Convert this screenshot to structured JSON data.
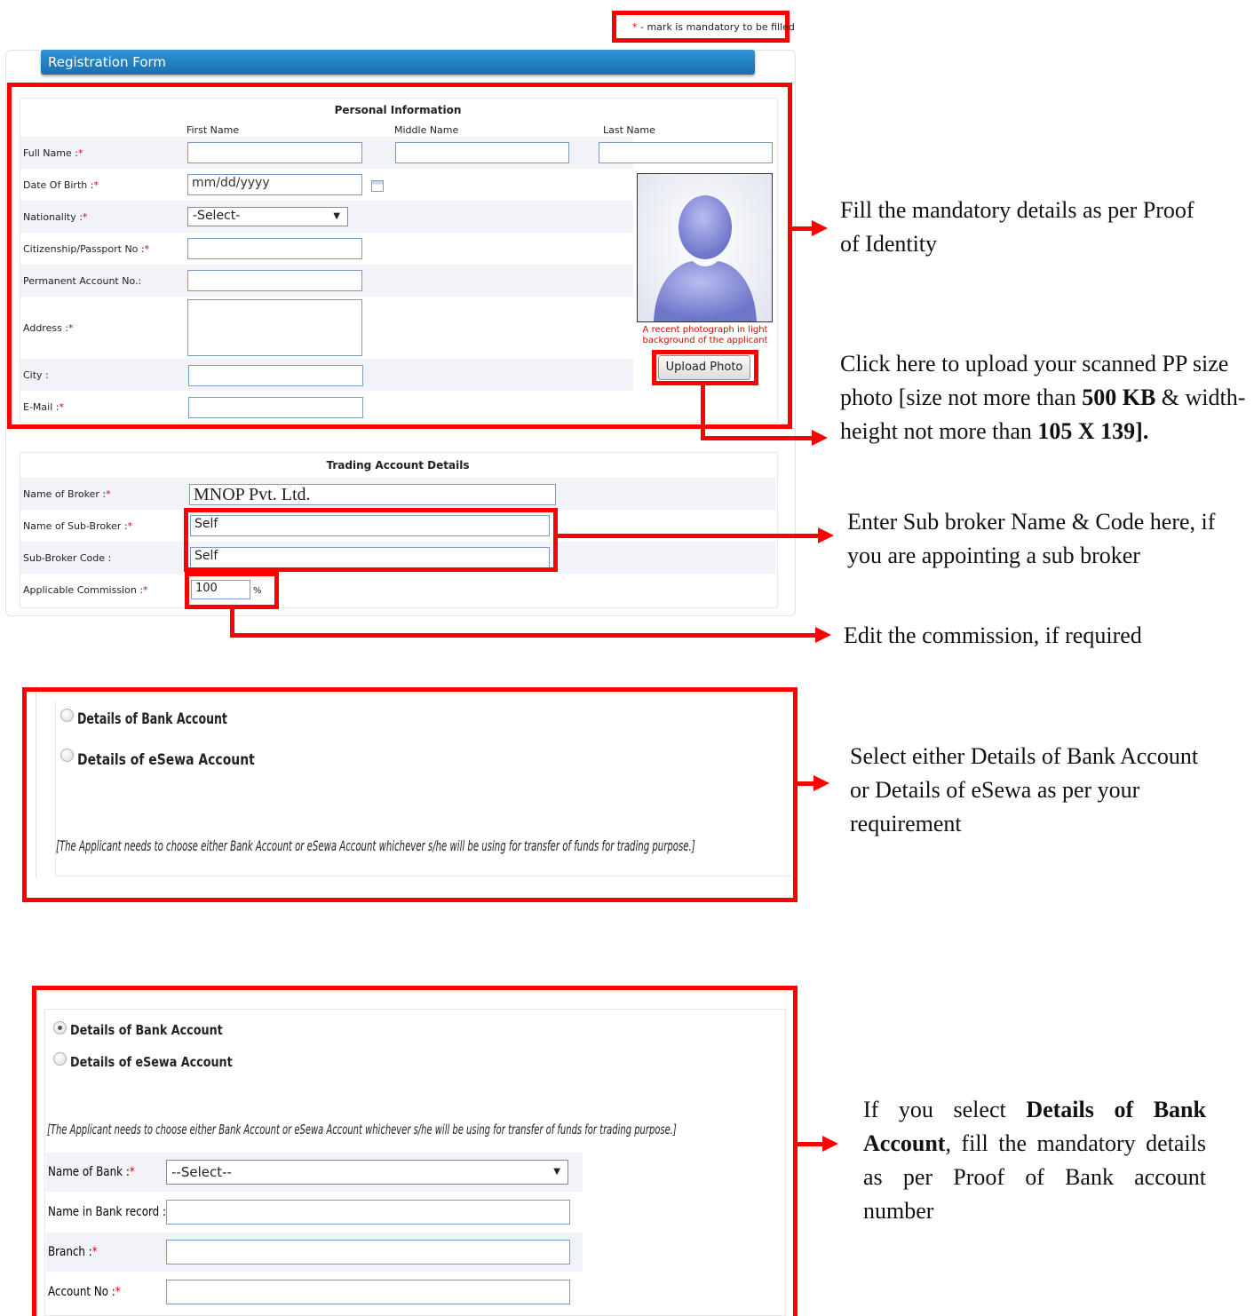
{
  "mandatory_note": {
    "star": "*",
    "text": " - mark is mandatory to be filled"
  },
  "form_header": "Registration Form",
  "personal": {
    "title": "Personal Information",
    "col_first": "First Name",
    "col_middle": "Middle Name",
    "col_last": "Last Name",
    "full_name": "Full Name :",
    "dob": "Date Of Birth :",
    "dob_placeholder": "mm/dd/yyyy",
    "nationality": "Nationality :",
    "nationality_value": "-Select-",
    "citizenship": "Citizenship/Passport No :",
    "pan": "Permanent Account No.:",
    "address": "Address :",
    "city": "City :",
    "email": "E-Mail :",
    "star": "*",
    "photo_caption": "A recent photograph in light background of the applicant",
    "upload_button": "Upload Photo"
  },
  "trading": {
    "title": "Trading Account Details",
    "broker_label": "Name of Broker :",
    "broker_value": "MNOP Pvt. Ltd.",
    "subbroker_label": "Name of Sub-Broker :",
    "subbroker_value": "Self",
    "subcode_label": "Sub-Broker Code :",
    "subcode_value": "Self",
    "commission_label": "Applicable Commission :",
    "commission_value": "100",
    "commission_unit": "%",
    "star": "*"
  },
  "account_choice_1": {
    "bank_option": "Details of Bank Account",
    "esewa_option": "Details of eSewa Account",
    "note": "[The Applicant needs to choose either Bank Account or eSewa Account whichever s/he will be using for transfer of funds for trading purpose.]"
  },
  "account_choice_2": {
    "bank_option": "Details of Bank Account",
    "esewa_option": "Details of eSewa Account",
    "note": "[The Applicant needs to choose either Bank Account or eSewa Account whichever s/he will be using for transfer of funds for trading purpose.]",
    "bank_name_label": "Name of Bank :",
    "bank_name_value": "--Select--",
    "name_in_record_label": "Name in Bank record :",
    "branch_label": "Branch :",
    "account_no_label": "Account No :",
    "star": "*"
  },
  "annotations": {
    "a1": "Fill the mandatory details as per Proof of Identity",
    "a2_part1": "Click here to upload your scanned PP size photo [size not more than ",
    "a2_bold1": "500 KB",
    "a2_part2": " & width-height not more than ",
    "a2_bold2": "105 X 139].",
    "a3": "Enter Sub broker Name & Code here, if you are appointing a sub broker",
    "a4": "Edit the commission, if required",
    "a5": "Select either Details of Bank Account or Details of eSewa as per your requirement",
    "a6_part1": "If you select ",
    "a6_bold": "Details of Bank Account",
    "a6_part2": ", fill the mandatory details as per Proof of Bank account number"
  },
  "colors": {
    "annotation_red": "#ff0000",
    "header_blue": "#1c7fc4",
    "band": "#f1f3f9"
  }
}
